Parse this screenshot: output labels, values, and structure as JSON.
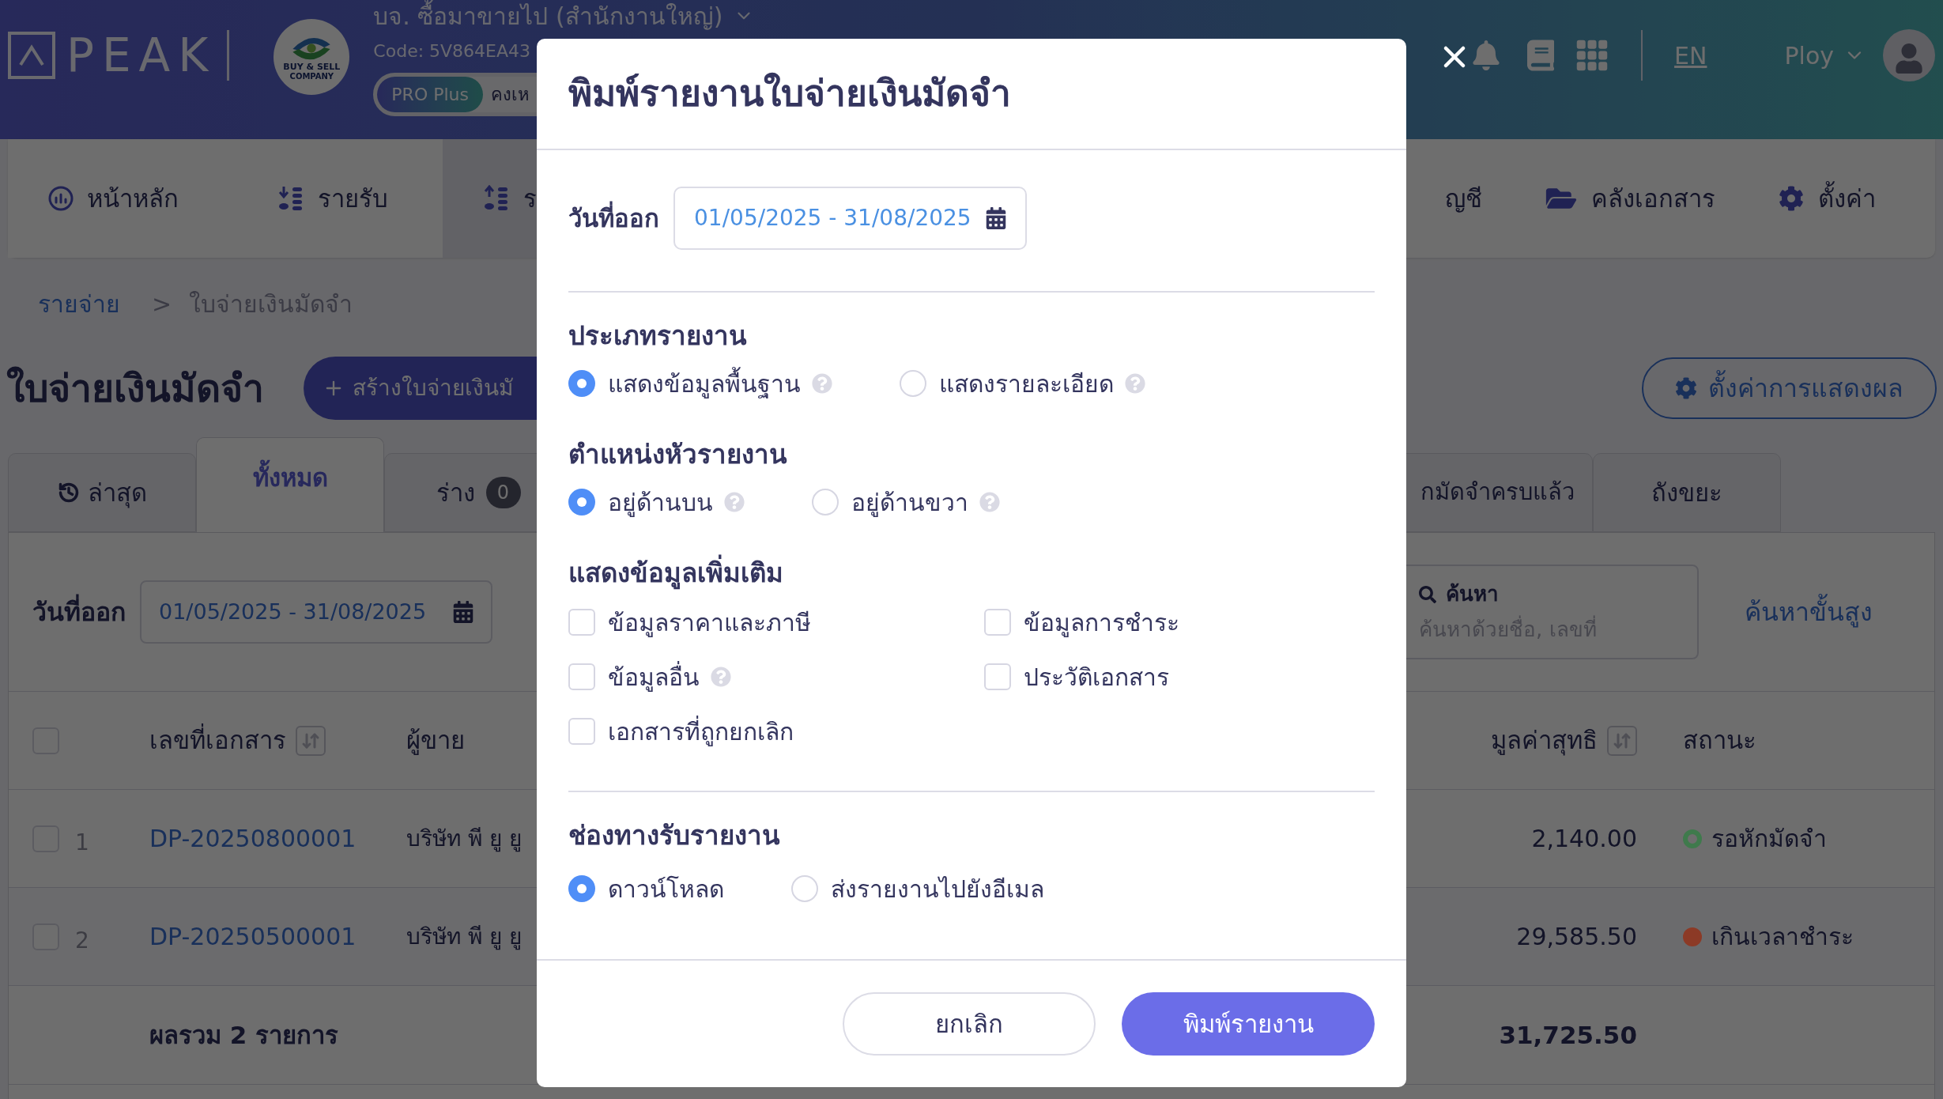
{
  "header": {
    "logo": "PEAK",
    "company": {
      "logo_text": "BUY & SELL",
      "logo_subtext": "COMPANY",
      "name": "บจ. ซื้อมาขายไป (สำนักงานใหญ่)",
      "code": "Code: 5V864EA43",
      "plan": "PRO Plus",
      "plan_note": "คงเห"
    },
    "language": "EN",
    "user": "Ploy"
  },
  "nav": [
    {
      "label": "หน้าหลัก",
      "selected": false
    },
    {
      "label": "รายรับ",
      "selected": false
    },
    {
      "label": "ร",
      "selected": true
    }
  ],
  "nav_right": [
    {
      "label": "ญชี"
    },
    {
      "label": "คลังเอกสาร"
    },
    {
      "label": "ตั้งค่า"
    }
  ],
  "breadcrumb": {
    "parent": "รายจ่าย",
    "separator": ">",
    "current": "ใบจ่ายเงินมัดจำ"
  },
  "page_title": "ใบจ่ายเงินมัดจำ",
  "create_button": "สร้างใบจ่ายเงินมั",
  "display_settings_button": "ตั้งค่าการแสดงผล",
  "tabs": [
    {
      "label": "ล่าสุด",
      "selected": false
    },
    {
      "label": "ทั้งหมด",
      "selected": true
    },
    {
      "label": "ร่าง",
      "count": "0",
      "selected": false
    },
    {
      "label": "กมัดจำครบแล้ว",
      "selected": false
    },
    {
      "label": "ถังขยะ",
      "selected": false
    }
  ],
  "filter": {
    "label": "วันที่ออก",
    "value": "01/05/2025 - 31/08/2025"
  },
  "search": {
    "label": "ค้นหา",
    "placeholder": "ค้นหาด้วยชื่อ, เลขที่"
  },
  "advanced_search": "ค้นหาขั้นสูง",
  "table": {
    "select_all": {
      "checked": false
    },
    "columns": [
      {
        "label": "เลขที่เอกสาร",
        "sortable": true
      },
      {
        "label": "ผู้ขาย",
        "sortable": false
      },
      {
        "label": "มูลค่าสุทธิ",
        "sortable": true
      },
      {
        "label": "สถานะ",
        "sortable": false
      }
    ],
    "rows": [
      {
        "checked": false,
        "number": "1",
        "doc": "DP-20250800001",
        "vendor": "บริษัท พี ยู ยู",
        "net": "2,140.00",
        "status": {
          "label": "รอหักมัดจำ",
          "kind": "ring",
          "color": "#3f7a4c"
        }
      },
      {
        "checked": false,
        "number": "2",
        "doc": "DP-20250500001",
        "vendor": "บริษัท พี ยู ยู",
        "net": "29,585.50",
        "status": {
          "label": "เกินเวลาชำระ",
          "kind": "dot",
          "color": "#8c3a26"
        }
      }
    ],
    "total": {
      "label": "ผลรวม 2 รายการ",
      "net": "31,725.50"
    }
  },
  "modal": {
    "title": "พิมพ์รายงานใบจ่ายเงินมัดจำ",
    "date": {
      "label": "วันที่ออก",
      "value": "01/05/2025 - 31/08/2025"
    },
    "sections": [
      {
        "title": "ประเภทรายงาน",
        "kind": "radio",
        "divided": false,
        "options": [
          {
            "label": "แสดงข้อมูลพื้นฐาน",
            "selected": true,
            "help": true
          },
          {
            "label": "แสดงรายละเอียด",
            "selected": false,
            "help": true
          }
        ]
      },
      {
        "title": "ตำแหน่งหัวรายงาน",
        "kind": "radio",
        "divided": false,
        "options": [
          {
            "label": "อยู่ด้านบน",
            "selected": true,
            "help": true
          },
          {
            "label": "อยู่ด้านขวา",
            "selected": false,
            "help": true
          }
        ]
      },
      {
        "title": "แสดงข้อมูลเพิ่มเติม",
        "kind": "checkbox",
        "divided": false,
        "options": [
          {
            "label": "ข้อมูลราคาและภาษี",
            "checked": false,
            "help": false
          },
          {
            "label": "ข้อมูลการชำระ",
            "checked": false,
            "help": false
          },
          {
            "label": "ข้อมูลอื่น",
            "checked": false,
            "help": true
          },
          {
            "label": "ประวัติเอกสาร",
            "checked": false,
            "help": false
          },
          {
            "label": "เอกสารที่ถูกยกเลิก",
            "checked": false,
            "help": false
          }
        ]
      },
      {
        "title": "ช่องทางรับรายงาน",
        "kind": "radio",
        "divided": true,
        "options": [
          {
            "label": "ดาวน์โหลด",
            "selected": true,
            "help": false
          },
          {
            "label": "ส่งรายงานไปยังอีเมล",
            "selected": false,
            "help": false
          }
        ]
      }
    ],
    "cancel": "ยกเลิก",
    "submit": "พิมพ์รายงาน"
  }
}
